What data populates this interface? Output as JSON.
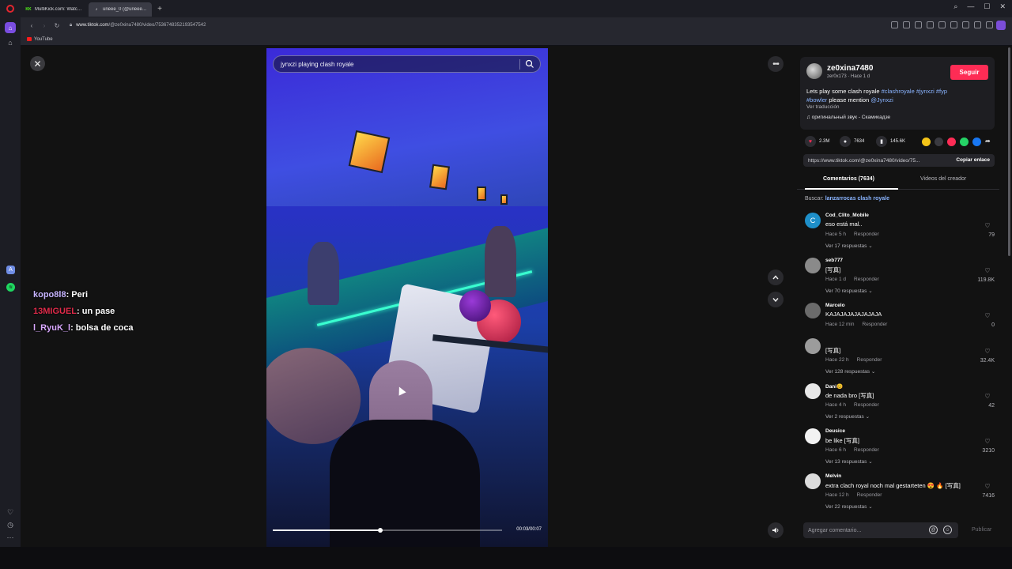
{
  "browser": {
    "tabs": [
      {
        "label": "MultiKick.com: Watch Mu",
        "favicon": "KK"
      },
      {
        "label": "urieee_0 (@urieee_0)",
        "favicon": "♪"
      }
    ],
    "new_tab": "+",
    "url_host": "www.tiktok.com",
    "url_path": "/@ze0xina7480/video/7536748352193547542",
    "bookmarks": [
      "YouTube"
    ],
    "accent": "#7a4de0"
  },
  "video": {
    "search_query": "jynxzi playing clash royale",
    "timecode": "00:03/00:07",
    "progress": 0.47
  },
  "chat": [
    {
      "user": "kopo8l8",
      "user_color": "#c6b4ff",
      "message": ": Peri"
    },
    {
      "user": "13MIGUEL",
      "user_color": "#e02b4a",
      "message": ": un pase"
    },
    {
      "user": "l_RyuK_l",
      "user_color": "#d9a8ff",
      "message": ": bolsa de coca"
    }
  ],
  "creator": {
    "handle": "ze0xina7480",
    "subline": "zer0x173 · Hace 1 d",
    "follow_label": "Seguir",
    "desc_text": "Lets play some clash royale ",
    "desc_tags": "#clashroyale #jynxzi #fyp",
    "desc_tag2": "#bowler",
    "desc_mid": " please mention ",
    "desc_mention": "@Jynxzi",
    "translate": "Ver traducción",
    "sound": "♫  оригинальный звук - Скамикадзе",
    "brand_color": "#fe2c55"
  },
  "stats": {
    "likes": "2.3M",
    "comments": "7634",
    "saves": "145.6K"
  },
  "share": {
    "link": "https://www.tiktok.com/@ze0xina7480/video/75...",
    "copy_label": "Copiar enlace"
  },
  "tabs": {
    "comments": "Comentarios (7634)",
    "creator_videos": "Videos del creador"
  },
  "search_suggest": {
    "prefix": "Buscar: ",
    "query": "lanzarrocas clash royale"
  },
  "comments": [
    {
      "user": "Cod_Clito_Mobile",
      "text": "eso está mal..",
      "time": "Hace 5 h",
      "reply": "Responder",
      "replies": "Ver 17 respuestas ⌄",
      "likes": "79",
      "avatar_color": "#1e8fc9",
      "avatar_letter": "C"
    },
    {
      "user": "seb777",
      "text": "[写真]",
      "time": "Hace 1 d",
      "reply": "Responder",
      "replies": "Ver 70 respuestas ⌄",
      "likes": "119.8K",
      "avatar_color": "#8a8a8a",
      "avatar_letter": ""
    },
    {
      "user": "Marcelo",
      "text": "KAJAJAJAJAJAJAJA",
      "time": "Hace 12 min",
      "reply": "Responder",
      "replies": "",
      "likes": "0",
      "avatar_color": "#6b6b6b",
      "avatar_letter": ""
    },
    {
      "user": "",
      "text": "[写真]",
      "time": "Hace 22 h",
      "reply": "Responder",
      "replies": "Ver 128 respuestas ⌄",
      "likes": "32.4K",
      "avatar_color": "#9c9c9c",
      "avatar_letter": ""
    },
    {
      "user": "Dani😊",
      "text": "de nada bro [写真]",
      "time": "Hace 4 h",
      "reply": "Responder",
      "replies": "Ver 2 respuestas ⌄",
      "likes": "42",
      "avatar_color": "#e8e8e8",
      "avatar_letter": ""
    },
    {
      "user": "Deusice",
      "text": "be like [写真]",
      "time": "Hace 6 h",
      "reply": "Responder",
      "replies": "Ver 13 respuestas ⌄",
      "likes": "3210",
      "avatar_color": "#f2f2f2",
      "avatar_letter": ""
    },
    {
      "user": "Melvin",
      "text": "extra clach royal noch mal gestarteten 😍 🔥 [写真]",
      "time": "Hace 12 h",
      "reply": "Responder",
      "replies": "Ver 22 respuestas ⌄",
      "likes": "7416",
      "avatar_color": "#dcdcdc",
      "avatar_letter": ""
    }
  ],
  "composer": {
    "placeholder": "Agregar comentario...",
    "publish": "Publicar"
  }
}
